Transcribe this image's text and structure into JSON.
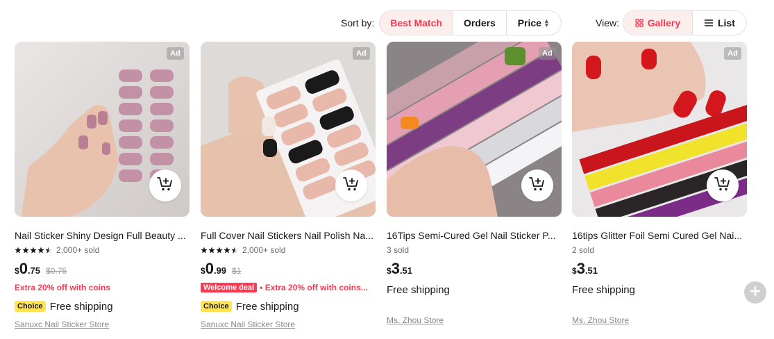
{
  "toolbar": {
    "sort_label": "Sort by:",
    "sort_options": [
      "Best Match",
      "Orders",
      "Price"
    ],
    "active_sort": "Best Match",
    "view_label": "View:",
    "view_options": [
      "Gallery",
      "List"
    ],
    "active_view": "Gallery"
  },
  "colors": {
    "accent": "#fd384f",
    "choice_badge": "#ffe554",
    "active_bg": "#fdeeee"
  },
  "products": [
    {
      "ad": "Ad",
      "title": "Nail Sticker Shiny Design Full Beauty ...",
      "rating": 4.5,
      "sold": "2,000+ sold",
      "currency": "$",
      "price_int": "0",
      "price_dec": ".75",
      "original_price": "$0.75",
      "welcome_badge": "",
      "promo": "Extra 20% off with coins",
      "choice_badge": "Choice",
      "shipping": "Free shipping",
      "store": "Sanuxc Nail Sticker Store"
    },
    {
      "ad": "Ad",
      "title": "Full Cover Nail Stickers Nail Polish Na...",
      "rating": 4.5,
      "sold": "2,000+ sold",
      "currency": "$",
      "price_int": "0",
      "price_dec": ".99",
      "original_price": "$1",
      "welcome_badge": "Welcome deal",
      "promo": "• Extra 20% off with coins...",
      "choice_badge": "Choice",
      "shipping": "Free shipping",
      "store": "Sanuxc Nail Sticker Store"
    },
    {
      "ad": "Ad",
      "title": "16Tips Semi-Cured Gel Nail Sticker P...",
      "sold": "3 sold",
      "currency": "$",
      "price_int": "3",
      "price_dec": ".51",
      "shipping": "Free shipping",
      "store": "Ms. Zhou Store"
    },
    {
      "ad": "Ad",
      "title": "16tips Glitter Foil Semi Cured Gel Nai...",
      "sold": "2 sold",
      "currency": "$",
      "price_int": "3",
      "price_dec": ".51",
      "shipping": "Free shipping",
      "store": "Ms. Zhou Store"
    }
  ],
  "icons": [
    "gallery-icon",
    "list-icon",
    "sort-arrows-icon",
    "add-to-cart-icon",
    "star-icon",
    "plus-icon"
  ]
}
